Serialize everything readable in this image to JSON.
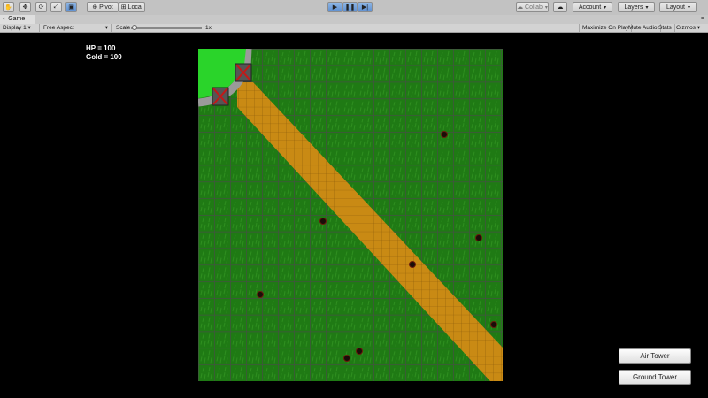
{
  "toolbar": {
    "pivot_label": "Pivot",
    "local_label": "Local",
    "collab_label": "Collab",
    "account_label": "Account",
    "layers_label": "Layers",
    "layout_label": "Layout"
  },
  "game_tab": {
    "label": "Game"
  },
  "game_options": {
    "display": "Display 1",
    "aspect": "Free Aspect",
    "scale_label": "Scale",
    "scale_value": "1x",
    "maximize": "Maximize On Play",
    "mute": "Mute Audio",
    "stats": "Stats",
    "gizmos": "Gizmos"
  },
  "hud": {
    "hp": "HP = 100",
    "gold": "Gold = 100"
  },
  "buttons": {
    "air_tower": "Air Tower",
    "ground_tower": "Ground Tower"
  },
  "colors": {
    "grass": "#1f7a14",
    "path": "#c98a14",
    "base": "#2ad42a",
    "grid": "#4a4a4a",
    "enemy": "#1a0d08"
  }
}
